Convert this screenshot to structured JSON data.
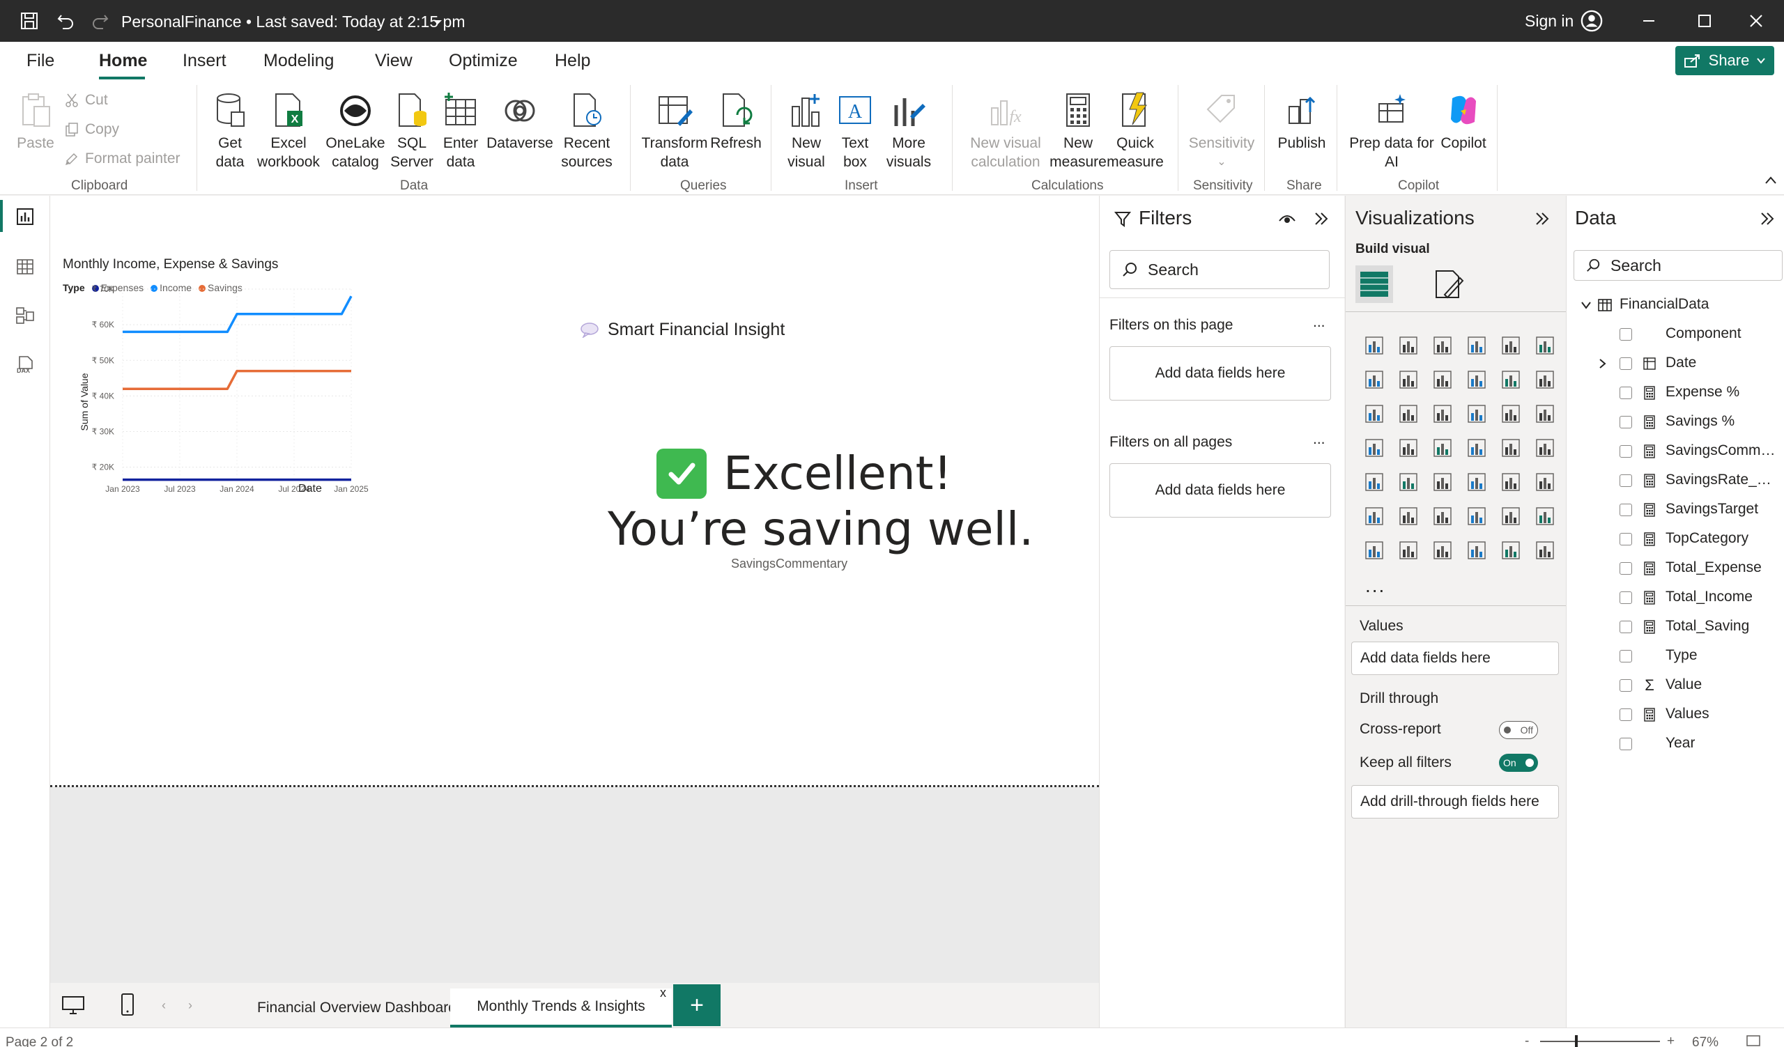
{
  "titlebar": {
    "title": "PersonalFinance • Last saved: Today at 2:15 pm",
    "sign_in": "Sign in"
  },
  "ribbon_tabs": [
    {
      "label": "File"
    },
    {
      "label": "Home",
      "active": true
    },
    {
      "label": "Insert"
    },
    {
      "label": "Modeling"
    },
    {
      "label": "View"
    },
    {
      "label": "Optimize"
    },
    {
      "label": "Help"
    }
  ],
  "share_label": "Share",
  "clipboard": {
    "paste": "Paste",
    "cut": "Cut",
    "copy": "Copy",
    "format_painter": "Format painter",
    "group": "Clipboard"
  },
  "data_group": {
    "get_data": [
      "Get",
      "data"
    ],
    "excel": [
      "Excel",
      "workbook"
    ],
    "onelake": [
      "OneLake",
      "catalog"
    ],
    "sql": [
      "SQL",
      "Server"
    ],
    "enter": [
      "Enter",
      "data"
    ],
    "dataverse": "Dataverse",
    "recent": [
      "Recent",
      "sources"
    ],
    "group": "Data"
  },
  "queries_group": {
    "transform": [
      "Transform",
      "data"
    ],
    "refresh": "Refresh",
    "group": "Queries"
  },
  "insert_group": {
    "new_visual": [
      "New",
      "visual"
    ],
    "text_box": [
      "Text",
      "box"
    ],
    "more_visuals": [
      "More",
      "visuals"
    ],
    "group": "Insert"
  },
  "calc_group": {
    "new_visual_calc": [
      "New visual",
      "calculation"
    ],
    "new_measure": [
      "New",
      "measure"
    ],
    "quick_measure": [
      "Quick",
      "measure"
    ],
    "group": "Calculations"
  },
  "sensitivity_group": {
    "sensitivity": "Sensitivity",
    "group": "Sensitivity"
  },
  "share_group": {
    "publish": "Publish",
    "group": "Share"
  },
  "copilot_group": {
    "prep": [
      "Prep data for",
      "AI"
    ],
    "copilot": "Copilot",
    "group": "Copilot"
  },
  "chart_data": {
    "type": "line",
    "title": "Monthly Income, Expense & Savings",
    "legend_title": "Type",
    "xlabel": "Date",
    "ylabel": "Sum of Value",
    "x_ticks": [
      "Jan 2023",
      "Jul 2023",
      "Jan 2024",
      "Jul 2024",
      "Jan 2025"
    ],
    "y_ticks": [
      "₹ 20K",
      "₹ 30K",
      "₹ 40K",
      "₹ 50K",
      "₹ 60K",
      "₹ 70K"
    ],
    "ylim": [
      17000,
      70000
    ],
    "xlim": [
      "2023-01",
      "2025-01"
    ],
    "legend_position": "top-left",
    "series": [
      {
        "name": "Expenses",
        "color": "#12239e",
        "points": [
          [
            "2023-01",
            16000
          ],
          [
            "2025-01",
            16000
          ]
        ]
      },
      {
        "name": "Income",
        "color": "#118dff",
        "points": [
          [
            "2023-01",
            58000
          ],
          [
            "2023-12",
            58000
          ],
          [
            "2024-01",
            63000
          ],
          [
            "2024-12",
            63000
          ],
          [
            "2025-01",
            68000
          ]
        ]
      },
      {
        "name": "Savings",
        "color": "#e66c37",
        "points": [
          [
            "2023-01",
            42000
          ],
          [
            "2023-12",
            42000
          ],
          [
            "2024-01",
            47000
          ],
          [
            "2025-01",
            47000
          ]
        ]
      }
    ]
  },
  "insight": {
    "title": "Smart Financial Insight",
    "line1": "Excellent!",
    "line2": "You’re saving well.",
    "caption": "SavingsCommentary"
  },
  "filters": {
    "title": "Filters",
    "search_placeholder": "Search",
    "this_page": "Filters on this page",
    "all_pages": "Filters on all pages",
    "add_fields": "Add data fields here",
    "more": "..."
  },
  "visualizations": {
    "title": "Visualizations",
    "build_visual": "Build visual",
    "values": "Values",
    "add_fields": "Add data fields here",
    "drill_through": "Drill through",
    "cross_report": "Cross-report",
    "cross_report_state": "Off",
    "keep_filters": "Keep all filters",
    "keep_filters_state": "On",
    "add_drill": "Add drill-through fields here",
    "more": "..."
  },
  "data_pane": {
    "title": "Data",
    "search_placeholder": "Search",
    "table": "FinancialData",
    "fields": [
      {
        "name": "Component",
        "icon": "none"
      },
      {
        "name": "Date",
        "icon": "table",
        "expandable": true
      },
      {
        "name": "Expense %",
        "icon": "calc"
      },
      {
        "name": "Savings %",
        "icon": "calc"
      },
      {
        "name": "SavingsComme...",
        "icon": "calc"
      },
      {
        "name": "SavingsRate_Pr...",
        "icon": "calc"
      },
      {
        "name": "SavingsTarget",
        "icon": "calc"
      },
      {
        "name": "TopCategory",
        "icon": "calc"
      },
      {
        "name": "Total_Expense",
        "icon": "calc"
      },
      {
        "name": "Total_Income",
        "icon": "calc"
      },
      {
        "name": "Total_Saving",
        "icon": "calc"
      },
      {
        "name": "Type",
        "icon": "none"
      },
      {
        "name": "Value",
        "icon": "sigma"
      },
      {
        "name": "Values",
        "icon": "calc"
      },
      {
        "name": "Year",
        "icon": "none"
      }
    ]
  },
  "page_tabs": [
    {
      "label": "Financial Overview Dashboard"
    },
    {
      "label": "Monthly Trends & Insights",
      "active": true
    }
  ],
  "page_tab_close": "x",
  "add_page": "+",
  "status": {
    "page": "Page 2 of 2",
    "zoom": "67%",
    "zoom_minus": "-",
    "zoom_plus": "+"
  }
}
